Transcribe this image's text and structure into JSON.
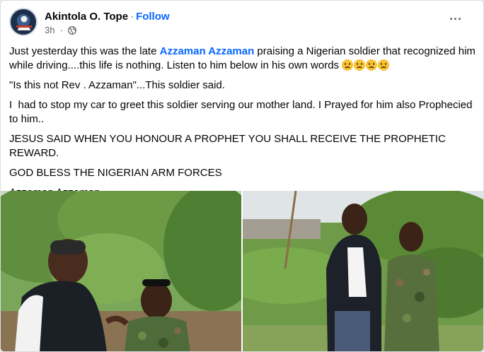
{
  "post": {
    "author": "Akintola O. Tope",
    "separator": "·",
    "follow_label": "Follow",
    "time": "3h",
    "privacy_icon": "globe-icon",
    "more_icon": "more-options-icon",
    "text": {
      "p1_before": "Just yesterday this was the late ",
      "p1_mention": "Azzaman Azzaman",
      "p1_after": " praising a Nigerian soldier that recognized him while driving....this life is nothing. Listen to him below in his own words ",
      "p2": "\"Is this not Rev . Azzaman\"...This soldier said.",
      "p3": "I  had to stop my car to greet this soldier serving our mother land. I Prayed for him also Prophecied to him..",
      "p4": "JESUS SAID WHEN YOU HONOUR A PROPHET YOU SHALL RECEIVE THE PROPHETIC REWARD.",
      "p5": "GOD BLESS THE NIGERIAN ARM FORCES",
      "p6": "Azzaman Azzaman"
    },
    "emoji_icons": [
      "sad-face-emoji",
      "sad-face-emoji",
      "sad-face-emoji",
      "sad-face-emoji"
    ],
    "photos": [
      "photo-man-with-soldier-1",
      "photo-man-with-soldier-2"
    ]
  },
  "colors": {
    "link": "#0866ff",
    "meta": "#65676b",
    "text": "#050505",
    "background": "#ffffff"
  }
}
